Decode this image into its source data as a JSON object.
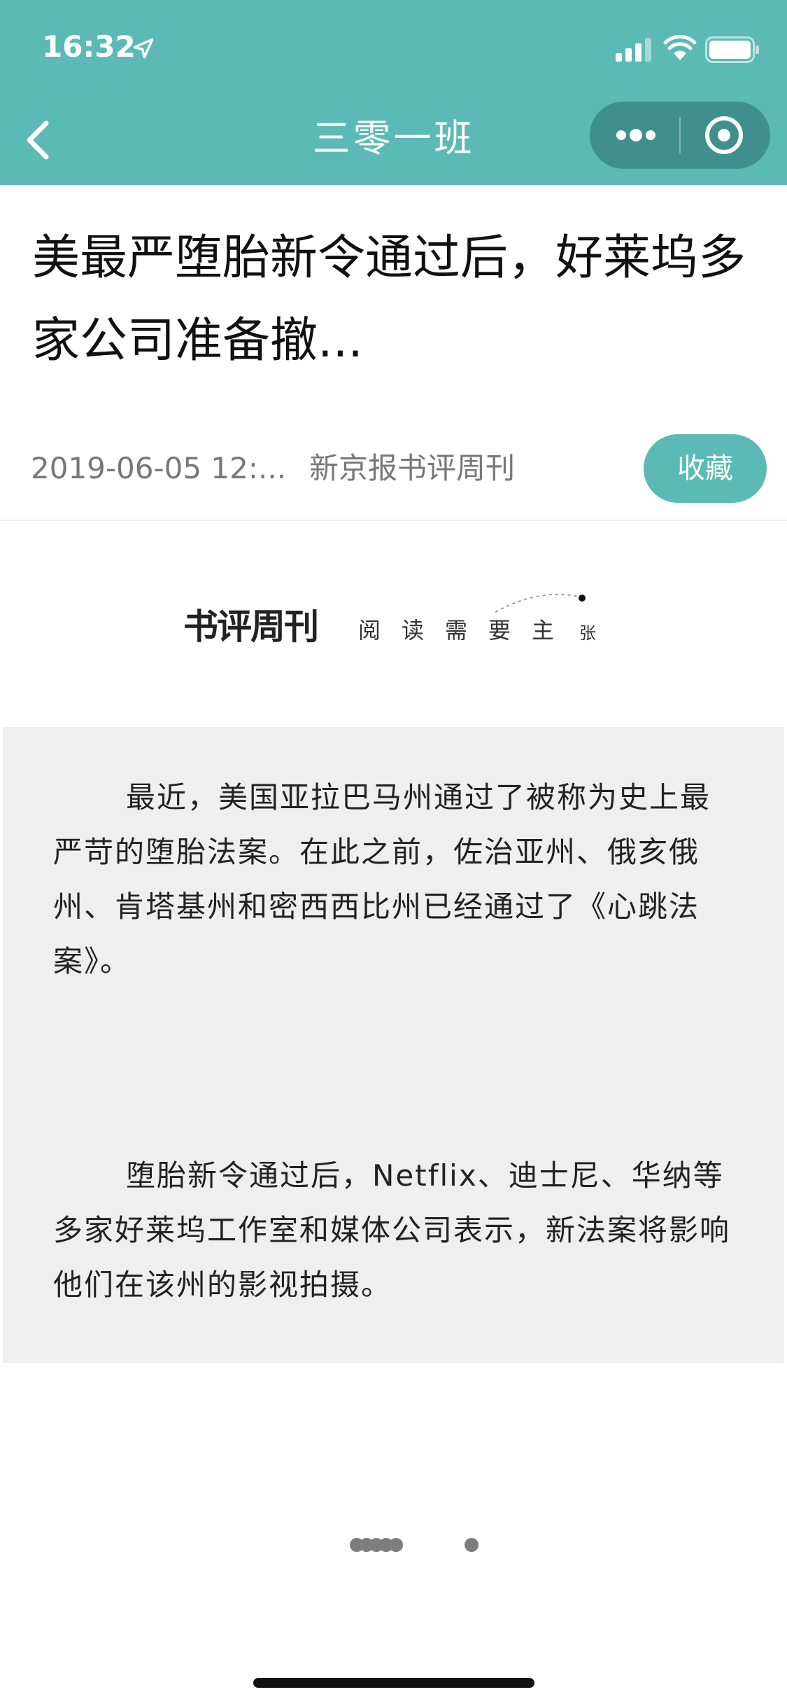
{
  "status_bar": {
    "time": "16:32"
  },
  "nav": {
    "title": "三零一班"
  },
  "article": {
    "title": "美最严堕胎新令通过后，好莱坞多家公司准备撤...",
    "date": "2019-06-05 12:...",
    "source": "新京报书评周刊",
    "favorite_label": "收藏"
  },
  "brand": {
    "logo": "书评周刊",
    "slogan": "阅读需要主",
    "slogan_tail": "张"
  },
  "body": {
    "paragraphs": [
      "最近，美国亚拉巴马州通过了被称为史上最严苛的堕胎法案。在此之前，佐治亚州、俄亥俄州、肯塔基州和密西西比州已经通过了《心跳法案》。",
      "堕胎新令通过后，Netflix、迪士尼、华纳等多家好莱坞工作室和媒体公司表示，新法案将影响他们在该州的影视拍摄。"
    ]
  },
  "colors": {
    "accent": "#5bbab5",
    "body_background": "#efefef"
  },
  "icons": [
    "location-icon",
    "signal-icon",
    "wifi-icon",
    "battery-icon",
    "back-arrow-icon",
    "more-dots-icon",
    "close-target-icon"
  ]
}
